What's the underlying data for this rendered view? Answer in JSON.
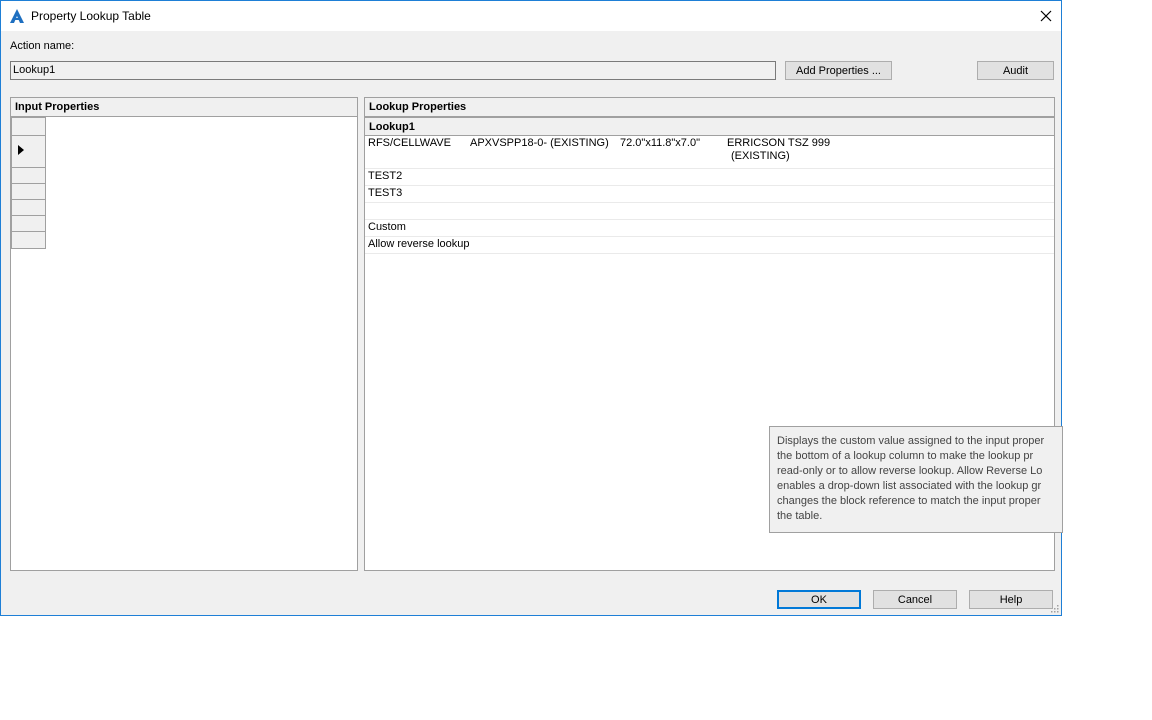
{
  "window": {
    "title": "Property Lookup Table"
  },
  "action": {
    "label": "Action name:",
    "value": "Lookup1"
  },
  "buttons": {
    "add_properties": "Add Properties ...",
    "audit": "Audit",
    "ok": "OK",
    "cancel": "Cancel",
    "help": "Help"
  },
  "input_panel": {
    "header": "Input Properties"
  },
  "lookup_panel": {
    "header": "Lookup Properties",
    "column": "Lookup1",
    "rows": [
      {
        "c1": "RFS/CELLWAVE",
        "c2": "APXVSPP18-0- (EXISTING)",
        "c3": "72.0\"x11.8\"x7.0\"",
        "c4a": "ERRICSON TSZ 999",
        "c4b": "(EXISTING)"
      },
      {
        "c1": "TEST2"
      },
      {
        "c1": "TEST3"
      },
      {
        "c1": ""
      },
      {
        "c1": "Custom"
      },
      {
        "c1": "Allow reverse lookup"
      }
    ]
  },
  "tooltip": {
    "lines": [
      "Displays the custom value assigned to the input proper",
      "the bottom of a lookup column to make the lookup pr",
      "read-only or to allow reverse lookup. Allow Reverse Lo",
      "enables a drop-down list associated with the lookup gr",
      "changes the block reference to match the input proper",
      "the table."
    ]
  }
}
